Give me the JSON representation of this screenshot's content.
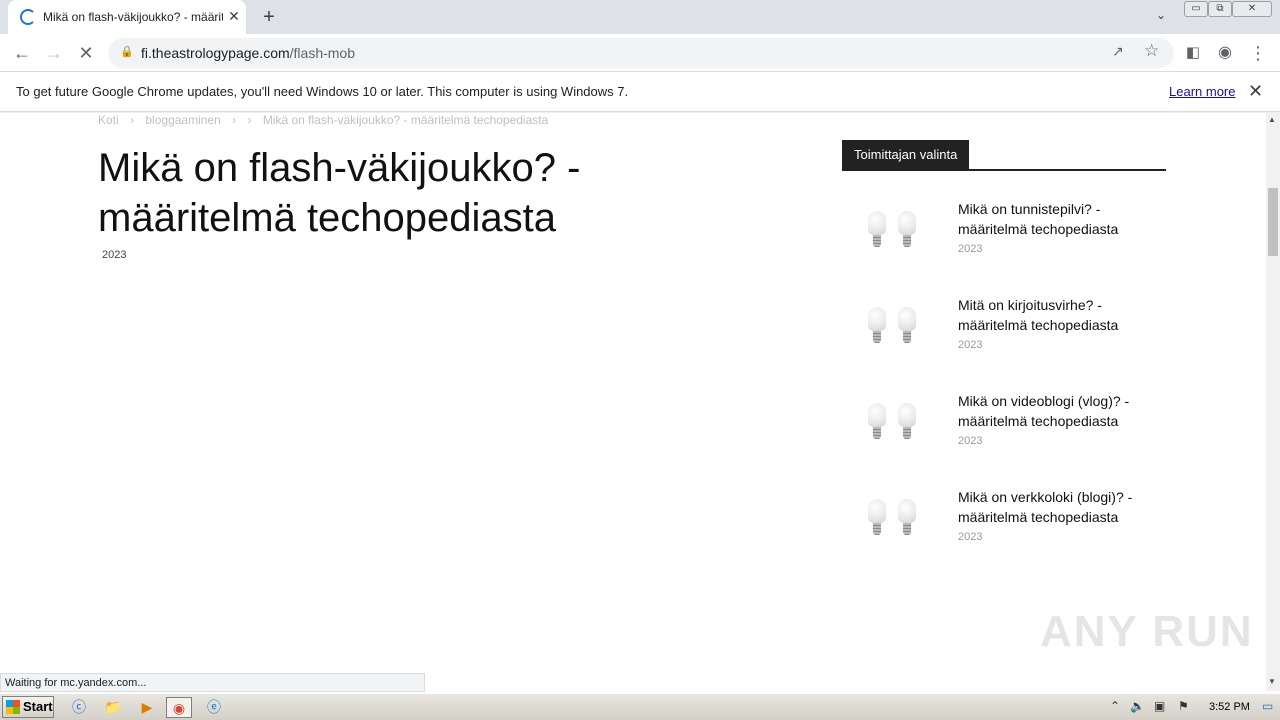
{
  "tab": {
    "title": "Mikä on flash-väkijoukko? - määritelmä techopediasta",
    "new_tab": "+",
    "close": "✕"
  },
  "window_controls": {
    "minimize": "▭",
    "restore": "⧉",
    "close": "✕"
  },
  "toolbar": {
    "url_host": "fi.theastrologypage.com",
    "url_path": "/flash-mob"
  },
  "infobar": {
    "message": "To get future Google Chrome updates, you'll need Windows 10 or later. This computer is using Windows 7.",
    "learn_more": "Learn more"
  },
  "page": {
    "breadcrumb": [
      "Koti",
      "›",
      "bloggaaminen",
      "›",
      "›",
      "Mikä on flash-väkijoukko? - määritelmä techopediasta"
    ],
    "title": "Mikä on flash-väkijoukko? - määritelmä techopediasta",
    "date": "2023"
  },
  "sidebar": {
    "header": "Toimittajan valinta",
    "items": [
      {
        "title": "Mikä on tunnistepilvi? - määritelmä techopediasta",
        "date": "2023"
      },
      {
        "title": "Mitä on kirjoitusvirhe? - määritelmä techopediasta",
        "date": "2023"
      },
      {
        "title": "Mikä on videoblogi (vlog)? - määritelmä techopediasta",
        "date": "2023"
      },
      {
        "title": "Mikä on verkkoloki (blogi)? - määritelmä techopediasta",
        "date": "2023"
      }
    ]
  },
  "watermark": "ANY RUN",
  "status": "Waiting for mc.yandex.com...",
  "taskbar": {
    "start": "Start",
    "clock": "3:52 PM"
  }
}
